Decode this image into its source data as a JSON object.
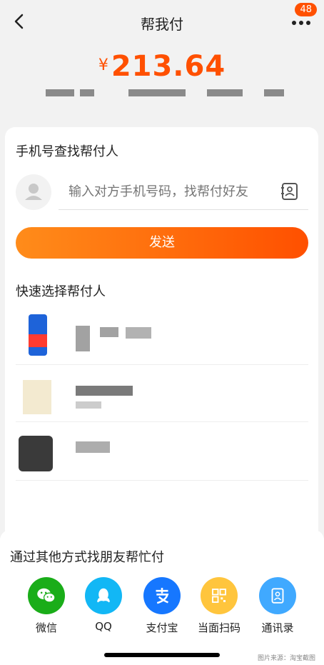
{
  "header": {
    "title": "帮我付",
    "badge": "48"
  },
  "amount": {
    "symbol": "¥",
    "value": "213.64"
  },
  "phone_search": {
    "title": "手机号查找帮付人",
    "placeholder": "输入对方手机号码，找帮付好友",
    "send_label": "发送"
  },
  "quick_select": {
    "title": "快速选择帮付人"
  },
  "other_ways": {
    "title": "通过其他方式找朋友帮忙付",
    "items": [
      {
        "label": "微信",
        "color": "#1aad19",
        "icon": "wechat-icon"
      },
      {
        "label": "QQ",
        "color": "#12b7f5",
        "icon": "qq-icon"
      },
      {
        "label": "支付宝",
        "color": "#1677ff",
        "icon": "alipay-icon"
      },
      {
        "label": "当面扫码",
        "color": "#ffc53d",
        "icon": "qrcode-icon"
      },
      {
        "label": "通讯录",
        "color": "#40a9ff",
        "icon": "contacts-icon"
      }
    ]
  },
  "credit": "图片来源：淘宝截图",
  "colors": {
    "accent": "#ff5000"
  }
}
